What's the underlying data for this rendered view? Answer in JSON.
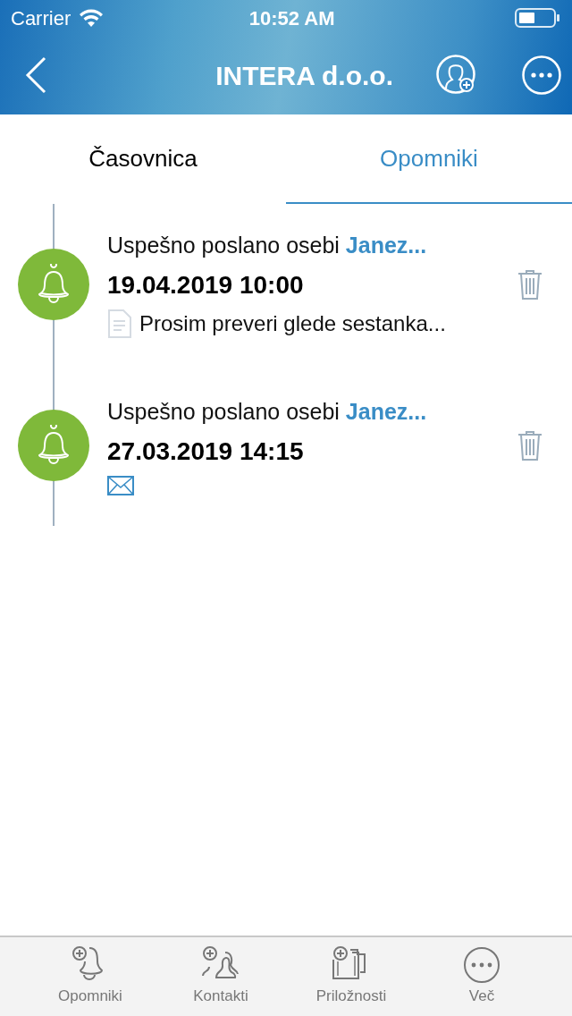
{
  "status_bar": {
    "carrier": "Carrier",
    "time": "10:52 AM"
  },
  "nav": {
    "title": "INTERA d.o.o."
  },
  "tabs": [
    {
      "label": "Časovnica",
      "selected": false
    },
    {
      "label": "Opomniki",
      "selected": true
    }
  ],
  "reminders": [
    {
      "status": "Uspešno poslano osebi",
      "recipient": "Janez...",
      "datetime": "19.04.2019 10:00",
      "kind": "note",
      "note": "Prosim preveri glede sestanka..."
    },
    {
      "status": "Uspešno poslano osebi",
      "recipient": "Janez...",
      "datetime": "27.03.2019 14:15",
      "kind": "email"
    }
  ],
  "tab_bar": [
    {
      "label": "Opomniki",
      "kind": "bell"
    },
    {
      "label": "Kontakti",
      "kind": "people"
    },
    {
      "label": "Priložnosti",
      "kind": "folder"
    },
    {
      "label": "Več",
      "kind": "more"
    }
  ]
}
